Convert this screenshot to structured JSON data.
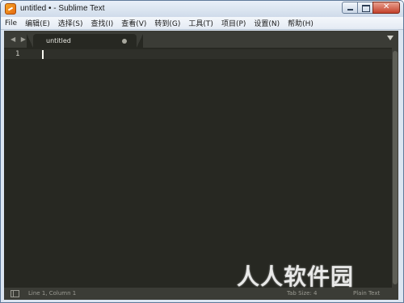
{
  "window": {
    "title": "untitled • - Sublime Text"
  },
  "menu": {
    "items": [
      "File",
      "编辑(E)",
      "选择(S)",
      "查找(I)",
      "查看(V)",
      "转到(G)",
      "工具(T)",
      "项目(P)",
      "设置(N)",
      "帮助(H)"
    ]
  },
  "tabs": {
    "nav": "◀ ▶",
    "active_label": "untitled"
  },
  "editor": {
    "line_number": "1",
    "content": ""
  },
  "status": {
    "position": "Line 1, Column 1",
    "tab_size": "Tab Size: 4",
    "syntax": "Plain Text"
  },
  "watermark": {
    "text": "人人软件园"
  },
  "colors": {
    "editor_bg": "#272822",
    "chrome_bg": "#3b3c36",
    "titlebar": "#dbe5f1"
  }
}
